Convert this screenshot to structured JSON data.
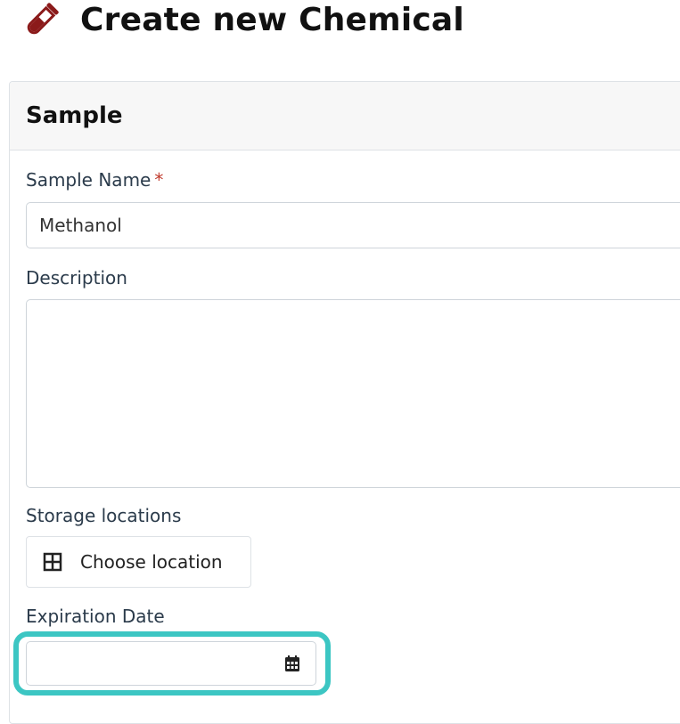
{
  "page": {
    "title": "Create new Chemical",
    "title_icon": "test-tube-icon",
    "accent_color": "#8b1a1a"
  },
  "section": {
    "title": "Sample"
  },
  "fields": {
    "sample_name": {
      "label": "Sample Name",
      "required_marker": "*",
      "value": "Methanol"
    },
    "description": {
      "label": "Description",
      "value": ""
    },
    "storage_locations": {
      "label": "Storage locations",
      "button_label": "Choose location",
      "button_icon": "grid-icon"
    },
    "expiration_date": {
      "label": "Expiration Date",
      "value": "",
      "icon": "calendar-icon",
      "highlight_color": "#3cc6c3"
    }
  }
}
